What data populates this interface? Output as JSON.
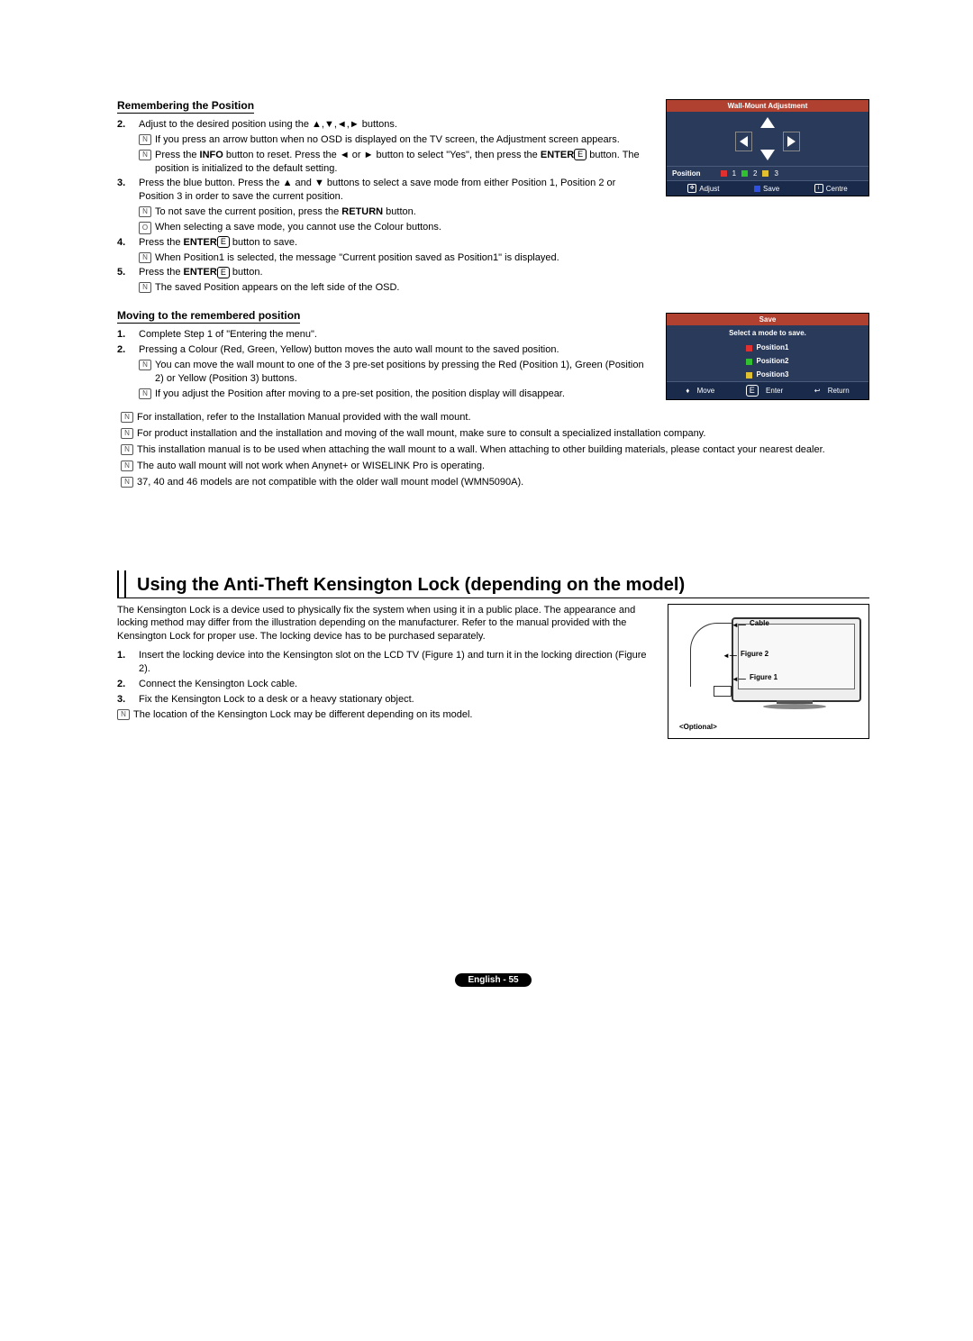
{
  "section1": {
    "heading": "Remembering the Position",
    "step2": "Adjust to the desired position using the ▲,▼,◄,► buttons.",
    "step2_notes": [
      "If you press an arrow button when no OSD is displayed on the TV screen, the Adjustment screen appears.",
      "Press the INFO button to reset. Press the ◄ or ► button to select \"Yes\", then press the ENTER button. The position is initialized to the default setting."
    ],
    "step3": "Press the blue button. Press the ▲ and ▼ buttons to select a save mode from either Position 1, Position 2 or Position 3 in order to save the current position.",
    "step3_notes": [
      "To not save the current position, press the RETURN button.",
      "When selecting a save mode, you cannot use the Colour buttons."
    ],
    "step3_note_types": [
      "note",
      "remote"
    ],
    "step4": "Press the ENTER button to save.",
    "step4_notes": [
      "When Position1 is selected, the message \"Current position saved as Position1\" is displayed."
    ],
    "step5": "Press the ENTER button.",
    "step5_notes": [
      "The saved Position appears on the left side of the OSD."
    ]
  },
  "osd1": {
    "title": "Wall-Mount Adjustment",
    "position_label": "Position",
    "pos1": "1",
    "pos2": "2",
    "pos3": "3",
    "bar": {
      "adjust": "Adjust",
      "save": "Save",
      "centre": "Centre"
    }
  },
  "section2": {
    "heading": "Moving to the remembered position",
    "step1": "Complete Step 1 of \"Entering the menu\".",
    "step2": "Pressing a Colour (Red, Green, Yellow) button moves the auto wall mount to the saved position.",
    "step2_notes": [
      "You can move the wall mount to one of the 3 pre-set positions by pressing the Red (Position 1), Green (Position 2) or Yellow (Position 3) buttons.",
      "If you adjust the Position after moving to a pre-set position, the position display will disappear."
    ]
  },
  "osd2": {
    "title": "Save",
    "subtitle": "Select a mode to save.",
    "items": [
      "Position1",
      "Position2",
      "Position3"
    ],
    "bar": {
      "move": "Move",
      "enter": "Enter",
      "return": "Return"
    }
  },
  "general_notes": [
    "For installation, refer to the Installation Manual provided with the wall mount.",
    "For product installation and the installation and moving of the wall mount, make sure to consult a specialized installation company.",
    "This installation manual is to be used when attaching the wall mount to a wall. When attaching to other building materials, please contact your nearest dealer.",
    "The auto wall mount will not work when Anynet+  or WISELINK Pro is operating.",
    "37, 40 and 46 models are not compatible with the older wall mount model (WMN5090A)."
  ],
  "kensington": {
    "heading": "Using the Anti-Theft Kensington Lock (depending on the model)",
    "intro": "The Kensington Lock is a device used to physically fix the system when using it in a public place. The appearance and locking method may differ from the illustration depending on the manufacturer. Refer to the manual provided with the Kensington Lock for proper use. The locking device has to be purchased separately.",
    "step1": "Insert the locking device into the Kensington slot on the LCD TV (Figure 1) and turn it in the locking direction (Figure 2).",
    "step2": "Connect the Kensington Lock cable.",
    "step3": "Fix the Kensington Lock to a desk or a heavy stationary object.",
    "note": "The location of the Kensington Lock may be different depending on its model.",
    "labels": {
      "cable": "Cable",
      "fig2": "Figure 2",
      "fig1": "Figure 1",
      "optional": "<Optional>"
    }
  },
  "footer": "English - 55",
  "icons": {
    "note": "N",
    "remote": "O",
    "enter": "E"
  }
}
